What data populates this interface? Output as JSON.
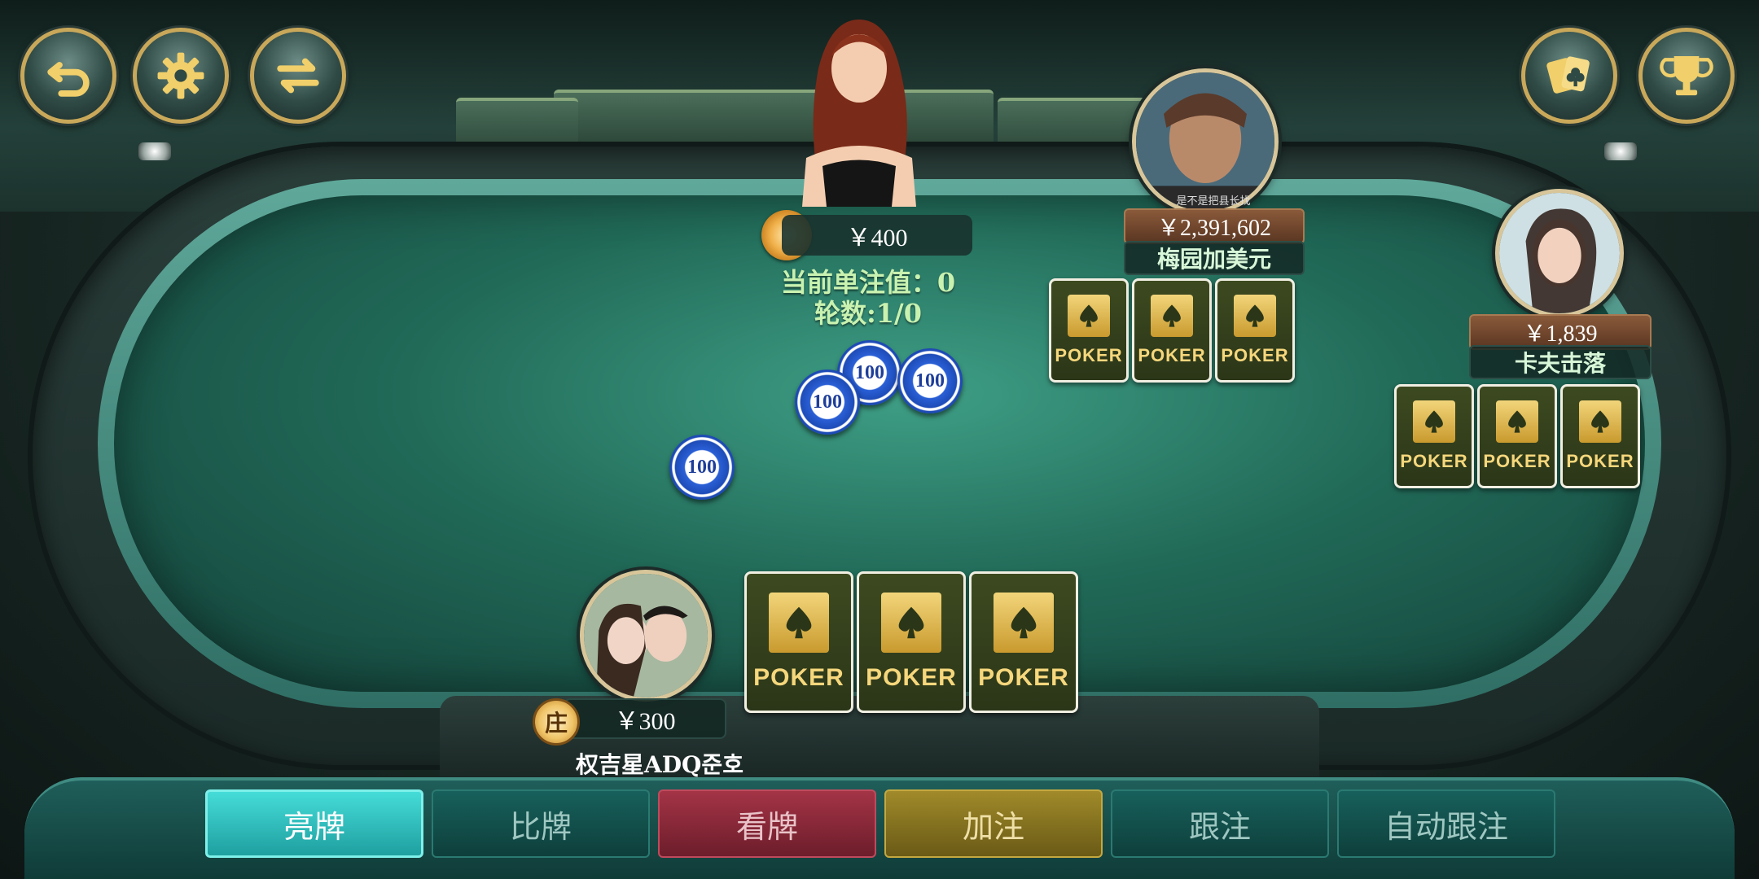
{
  "top_left_buttons": [
    {
      "icon": "back-arrow-icon"
    },
    {
      "icon": "gear-icon"
    },
    {
      "icon": "swap-icon"
    }
  ],
  "top_right_buttons": [
    {
      "icon": "cards-icon"
    },
    {
      "icon": "trophy-icon"
    }
  ],
  "pot": {
    "amount": "￥400"
  },
  "round_info": {
    "current_bet": "当前单注值：0",
    "round": "轮数:1/0"
  },
  "chips": [
    {
      "value": "100"
    },
    {
      "value": "100"
    },
    {
      "value": "100"
    },
    {
      "value": "100"
    }
  ],
  "players": {
    "top_right": {
      "money": "￥2,391,602",
      "name": "梅园加美元",
      "avatar_caption": "是不是把县长找"
    },
    "right": {
      "money": "￥1,839",
      "name": "卡夫击落"
    },
    "self": {
      "money": "￥300",
      "name": "权吉星ADQ준호",
      "banker_label": "庄"
    }
  },
  "card_back_text": "POKER",
  "actions": [
    {
      "label": "亮牌",
      "style": "active"
    },
    {
      "label": "比牌",
      "style": "teal"
    },
    {
      "label": "看牌",
      "style": "red"
    },
    {
      "label": "加注",
      "style": "gold"
    },
    {
      "label": "跟注",
      "style": "teal"
    },
    {
      "label": "自动跟注",
      "style": "teal"
    }
  ],
  "colors": {
    "felt": "#216a58",
    "active_button": "#2ec6c4",
    "red_button": "#8b2a3a",
    "gold_button": "#8a7420",
    "teal_button": "#12504c",
    "name_text": "#d8f6d8",
    "info_text": "#c9f2b0"
  }
}
